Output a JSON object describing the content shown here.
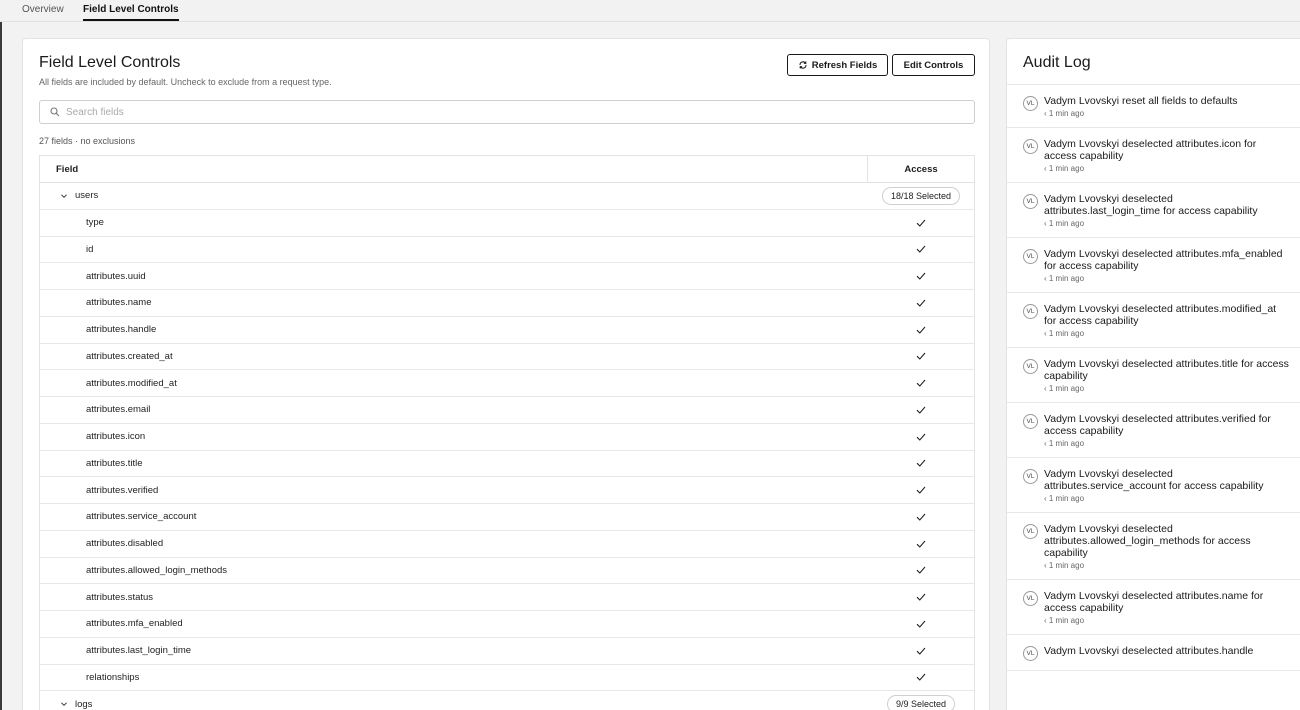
{
  "tabs": [
    {
      "label": "Overview",
      "active": false
    },
    {
      "label": "Field Level Controls",
      "active": true
    }
  ],
  "main": {
    "title": "Field Level Controls",
    "subtitle": "All fields are included by default. Uncheck to exclude from a request type.",
    "refresh_label": "Refresh Fields",
    "edit_label": "Edit Controls",
    "search_placeholder": "Search fields",
    "count_text": "27 fields · no exclusions",
    "table": {
      "col_field": "Field",
      "col_access": "Access",
      "groups": [
        {
          "name": "users",
          "badge": "18/18 Selected",
          "expanded": true,
          "fields": [
            "type",
            "id",
            "attributes.uuid",
            "attributes.name",
            "attributes.handle",
            "attributes.created_at",
            "attributes.modified_at",
            "attributes.email",
            "attributes.icon",
            "attributes.title",
            "attributes.verified",
            "attributes.service_account",
            "attributes.disabled",
            "attributes.allowed_login_methods",
            "attributes.status",
            "attributes.mfa_enabled",
            "attributes.last_login_time",
            "relationships"
          ]
        },
        {
          "name": "logs",
          "badge": "9/9 Selected",
          "expanded": true,
          "fields": []
        }
      ]
    }
  },
  "audit": {
    "title": "Audit Log",
    "entries": [
      {
        "avatar": "VL",
        "text": "Vadym Lvovskyi reset all fields to defaults",
        "time": "‹ 1 min ago"
      },
      {
        "avatar": "VL",
        "text": "Vadym Lvovskyi deselected attributes.icon for access capability",
        "time": "‹ 1 min ago"
      },
      {
        "avatar": "VL",
        "text": "Vadym Lvovskyi deselected attributes.last_login_time for access capability",
        "time": "‹ 1 min ago"
      },
      {
        "avatar": "VL",
        "text": "Vadym Lvovskyi deselected attributes.mfa_enabled for access capability",
        "time": "‹ 1 min ago"
      },
      {
        "avatar": "VL",
        "text": "Vadym Lvovskyi deselected attributes.modified_at for access capability",
        "time": "‹ 1 min ago"
      },
      {
        "avatar": "VL",
        "text": "Vadym Lvovskyi deselected attributes.title for access capability",
        "time": "‹ 1 min ago"
      },
      {
        "avatar": "VL",
        "text": "Vadym Lvovskyi deselected attributes.verified for access capability",
        "time": "‹ 1 min ago"
      },
      {
        "avatar": "VL",
        "text": "Vadym Lvovskyi deselected attributes.service_account for access capability",
        "time": "‹ 1 min ago"
      },
      {
        "avatar": "VL",
        "text": "Vadym Lvovskyi deselected attributes.allowed_login_methods for access capability",
        "time": "‹ 1 min ago"
      },
      {
        "avatar": "VL",
        "text": "Vadym Lvovskyi deselected attributes.name for access capability",
        "time": "‹ 1 min ago"
      },
      {
        "avatar": "VL",
        "text": "Vadym Lvovskyi deselected attributes.handle",
        "time": ""
      }
    ]
  }
}
